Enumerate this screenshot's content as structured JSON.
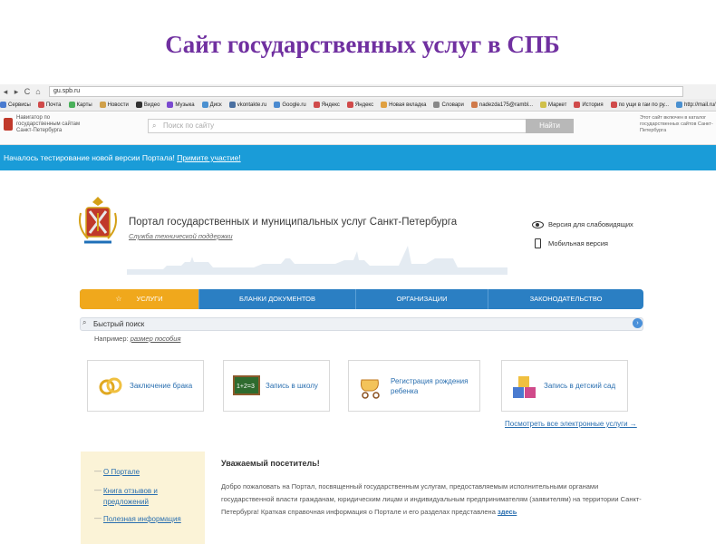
{
  "slide": {
    "title": "Сайт государственных услуг в СПБ"
  },
  "browser": {
    "url": "gu.spb.ru",
    "bookmarks": [
      {
        "label": "Сервисы",
        "color": "#4a7bd0"
      },
      {
        "label": "Почта",
        "color": "#d04a4a"
      },
      {
        "label": "Карты",
        "color": "#4ab05a"
      },
      {
        "label": "Новости",
        "color": "#d0a04a"
      },
      {
        "label": "Видео",
        "color": "#333333"
      },
      {
        "label": "Музыка",
        "color": "#7a4ad0"
      },
      {
        "label": "Диск",
        "color": "#4a90d0"
      },
      {
        "label": "vkontakte.ru",
        "color": "#4a6fa0"
      },
      {
        "label": "Google.ru",
        "color": "#4a8ad0"
      },
      {
        "label": "Яндекс",
        "color": "#d04a4a"
      },
      {
        "label": "Яндекс",
        "color": "#d04a4a"
      },
      {
        "label": "Новая вкладка",
        "color": "#e0a040"
      },
      {
        "label": "Словари",
        "color": "#888888"
      },
      {
        "label": "nadezda175@rambl...",
        "color": "#d07a4a"
      },
      {
        "label": "Маркет",
        "color": "#d0c04a"
      },
      {
        "label": "История",
        "color": "#d04a4a"
      },
      {
        "label": "по ущи в гаи по ру...",
        "color": "#d04a4a"
      },
      {
        "label": "http://mail.ru/cnt/7...",
        "color": "#4a90d0"
      }
    ]
  },
  "navigator": {
    "left_text": "Навигатор по государственным сайтам Санкт-Петербурга",
    "search_placeholder": "Поиск по сайту",
    "find_button": "Найти",
    "right_text": "Этот сайт включен в каталог государственных сайтов Санкт-Петербурга"
  },
  "banner": {
    "text": "Началось тестирование новой версии Портала!",
    "link": "Примите участие!"
  },
  "portal": {
    "title": "Портал государственных и муниципальных услуг Санкт-Петербурга",
    "support": "Служба технической поддержки",
    "accessibility": "Версия для слабовидящих",
    "mobile": "Мобильная версия"
  },
  "menu": {
    "items": [
      {
        "label": "УСЛУГИ"
      },
      {
        "label": "БЛАНКИ ДОКУМЕНТОВ"
      },
      {
        "label": "ОРГАНИЗАЦИИ"
      },
      {
        "label": "ЗАКОНОДАТЕЛЬСТВО"
      }
    ]
  },
  "quick_search": {
    "label": "Быстрый поиск",
    "example_prefix": "Например:",
    "example_link": "размер пособия"
  },
  "services": {
    "cards": [
      {
        "label": "Заключение брака",
        "icon": "rings-icon"
      },
      {
        "label": "Запись в школу",
        "icon": "chalkboard-icon"
      },
      {
        "label": "Регистрация рождения ребенка",
        "icon": "stroller-icon"
      },
      {
        "label": "Запись в детский сад",
        "icon": "toy-blocks-icon"
      }
    ],
    "all_link": "Посмотреть все электронные услуги →"
  },
  "sidebar": {
    "items": [
      {
        "label": "О Портале"
      },
      {
        "label": "Книга отзывов и предложений"
      },
      {
        "label": "Полезная информация"
      }
    ]
  },
  "welcome": {
    "heading": "Уважаемый посетитель!",
    "text": "Добро пожаловать на Портал, посвященный государственным услугам, предоставляемым исполнительными органами государственной власти гражданам, юридическим лицам и индивидуальным предпринимателям (заявителям) на территории Санкт-Петербурга! Краткая справочная информация о Портале и его разделах представлена",
    "link": "здесь"
  }
}
